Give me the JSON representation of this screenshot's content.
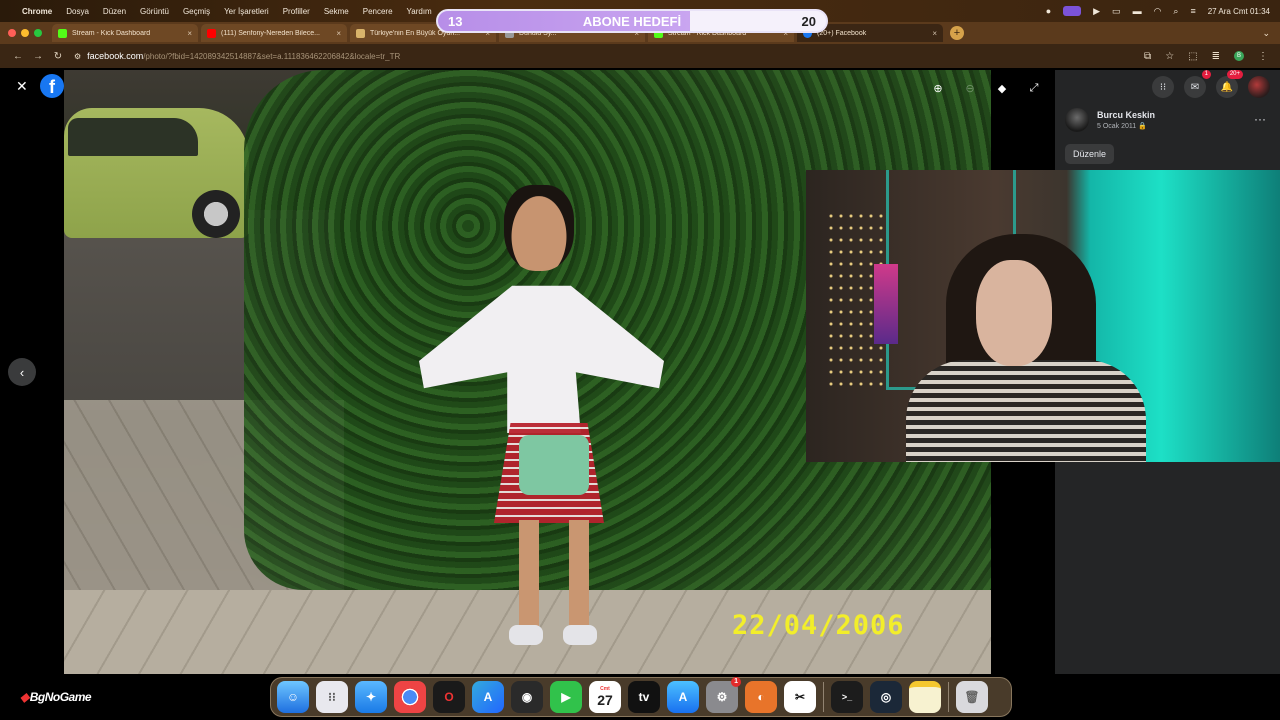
{
  "menubar": {
    "app": "Chrome",
    "items": [
      "Dosya",
      "Düzen",
      "Görüntü",
      "Geçmiş",
      "Yer İşaretleri",
      "Profiller",
      "Sekme",
      "Pencere",
      "Yardım"
    ],
    "clock": "27 Ara Cmt  01:34"
  },
  "goal": {
    "current": "13",
    "title": "ABONE HEDEFİ",
    "target": "20",
    "progress": 0.65
  },
  "tabs": [
    {
      "title": "Stream - Kick Dashboard",
      "icon": "kick-icon",
      "color": "#53fc18"
    },
    {
      "title": "(111) Senfony-Nereden Bilece...",
      "icon": "youtube-icon",
      "color": "#ff0000"
    },
    {
      "title": "Türkiye'nin En Büyük Oyun...",
      "icon": "site-icon",
      "color": "#d8b36a"
    },
    {
      "title": "Dunulu Sy...",
      "icon": "site-icon",
      "color": "#9a9a9a"
    },
    {
      "title": "Stream - Kick Dashboard",
      "icon": "kick-icon",
      "color": "#53fc18"
    },
    {
      "title": "(20+) Facebook",
      "icon": "facebook-icon",
      "color": "#1877f2"
    }
  ],
  "address": {
    "host": "facebook.com",
    "path": "/photo/?fbid=142089342514887&set=a.111836462206842&locale=tr_TR"
  },
  "photo": {
    "date_stamp": "22/04/2006"
  },
  "sidebar": {
    "author": "Burcu Keskin",
    "date": "5 Ocak 2011",
    "edit_label": "Düzenle",
    "messenger_badge": "1",
    "notifications_badge": "20+"
  },
  "dock": {
    "calendar_month": "Cmt",
    "calendar_day": "27",
    "settings_badge": "1"
  },
  "brand": {
    "name": "BgNoGame"
  },
  "colors": {
    "facebook_blue": "#1877f2",
    "sidebar_bg": "#242526",
    "date_stamp": "#f2ee2a"
  }
}
